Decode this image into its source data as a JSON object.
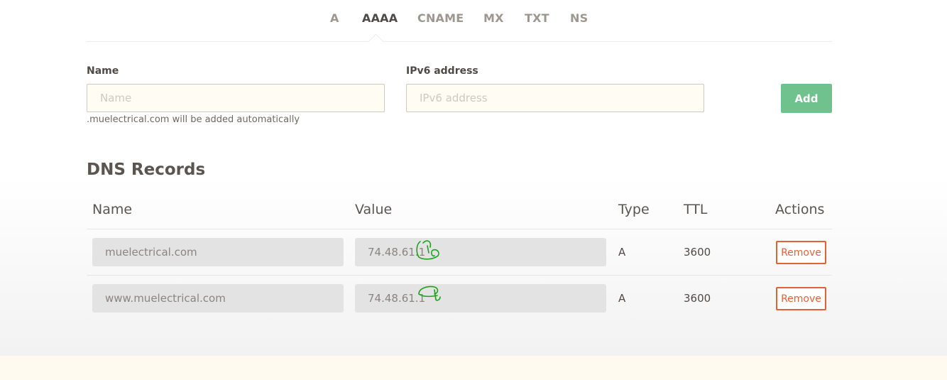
{
  "tabs": [
    "A",
    "AAAA",
    "CNAME",
    "MX",
    "TXT",
    "NS"
  ],
  "active_tab": "AAAA",
  "form": {
    "name_label": "Name",
    "name_placeholder": "Name",
    "name_hint": ".muelectrical.com will be added automatically",
    "ipv6_label": "IPv6 address",
    "ipv6_placeholder": "IPv6 address",
    "add_label": "Add"
  },
  "records": {
    "title": "DNS Records",
    "columns": {
      "name": "Name",
      "value": "Value",
      "type": "Type",
      "ttl": "TTL",
      "actions": "Actions"
    },
    "rows": [
      {
        "name": "muelectrical.com",
        "value": "74.48.61.1",
        "type": "A",
        "ttl": "3600",
        "action": "Remove"
      },
      {
        "name": "www.muelectrical.com",
        "value": "74.48.61.1",
        "type": "A",
        "ttl": "3600",
        "action": "Remove"
      }
    ]
  },
  "colors": {
    "add_button": "#6fc18e",
    "remove_button": "#e0623a",
    "annotation_scribble": "#1aa31a"
  }
}
